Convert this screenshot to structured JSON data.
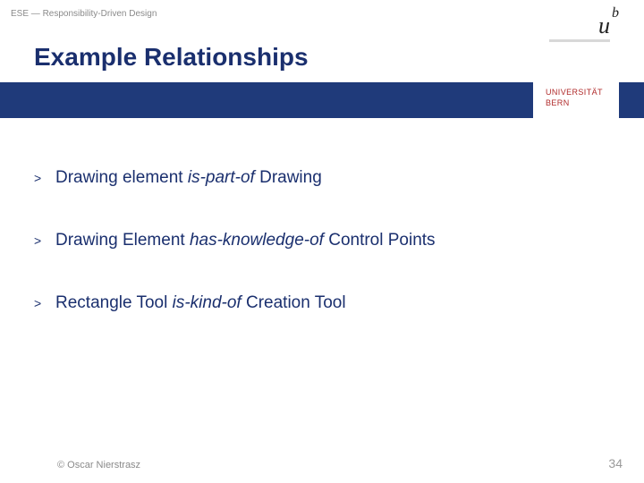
{
  "header": {
    "breadcrumb": "ESE — Responsibility-Driven Design",
    "title": "Example Relationships"
  },
  "logo": {
    "u": "u",
    "b": "b",
    "uni_line1": "UNIVERSITÄT",
    "uni_line2": "BERN"
  },
  "bullets": [
    {
      "marker": ">",
      "pre": "Drawing element ",
      "em": "is-part-of",
      "post": " Drawing"
    },
    {
      "marker": ">",
      "pre": "Drawing Element ",
      "em": "has-knowledge-of",
      "post": " Control Points"
    },
    {
      "marker": ">",
      "pre": "Rectangle Tool ",
      "em": "is-kind-of",
      "post": " Creation Tool"
    }
  ],
  "footer": {
    "copyright": "© Oscar Nierstrasz",
    "page": "34"
  }
}
